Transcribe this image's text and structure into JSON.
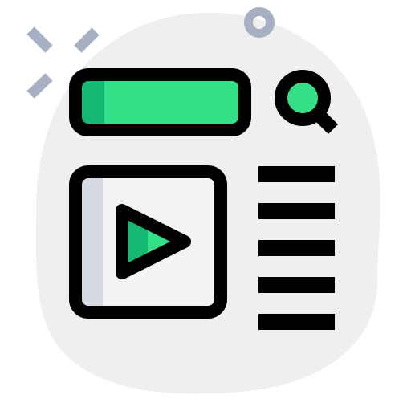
{
  "icon": {
    "name": "video-search-page-icon",
    "colors": {
      "outline": "#000000",
      "accent_green": "#33E088",
      "accent_green_dark": "#14B873",
      "blob_bg": "#EFEFEF",
      "panel_fill": "#F3F3F1",
      "panel_shadow": "#D6DAE3",
      "decor_gray": "#A7B0C2"
    },
    "parts": [
      "background-blob",
      "sparkle-decorations",
      "ring-decoration",
      "search-bar",
      "magnifier-icon",
      "video-player-panel",
      "play-icon",
      "text-lines"
    ],
    "text_line_count": 5
  }
}
